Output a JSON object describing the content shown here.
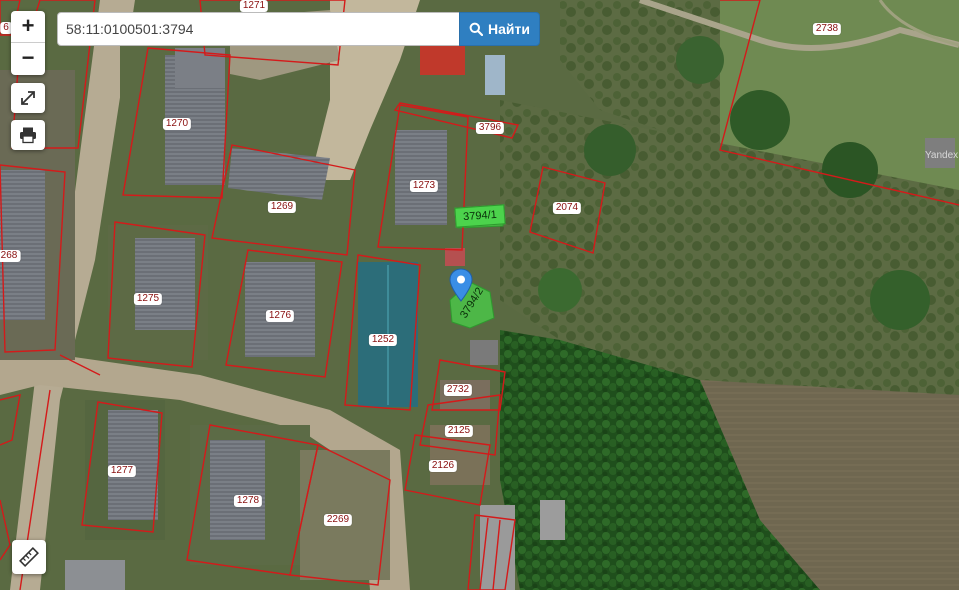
{
  "search": {
    "value": "58:11:0100501:3794",
    "button_label": "Найти"
  },
  "controls": {
    "zoom_in": "+",
    "zoom_out": "−"
  },
  "parcels": {
    "p1271": "1271",
    "p2738": "2738",
    "p1270": "1270",
    "p3796": "3796",
    "p1273": "1273",
    "p2074": "2074",
    "p1269": "1269",
    "p268": "268",
    "p1275": "1275",
    "p1276": "1276",
    "p1252": "1252",
    "p2732": "2732",
    "p2125": "2125",
    "p2126": "2126",
    "p1277": "1277",
    "p1278": "1278",
    "p2269": "2269",
    "p6": "6"
  },
  "highlight": {
    "label1": "3794/1",
    "label2": "3794/2"
  },
  "provider_mark": "Yandex",
  "colors": {
    "parcel_border": "#d41a1a",
    "highlight_fill": "#49d149",
    "search_button": "#2f7fc1",
    "marker": "#3a8ee6"
  }
}
